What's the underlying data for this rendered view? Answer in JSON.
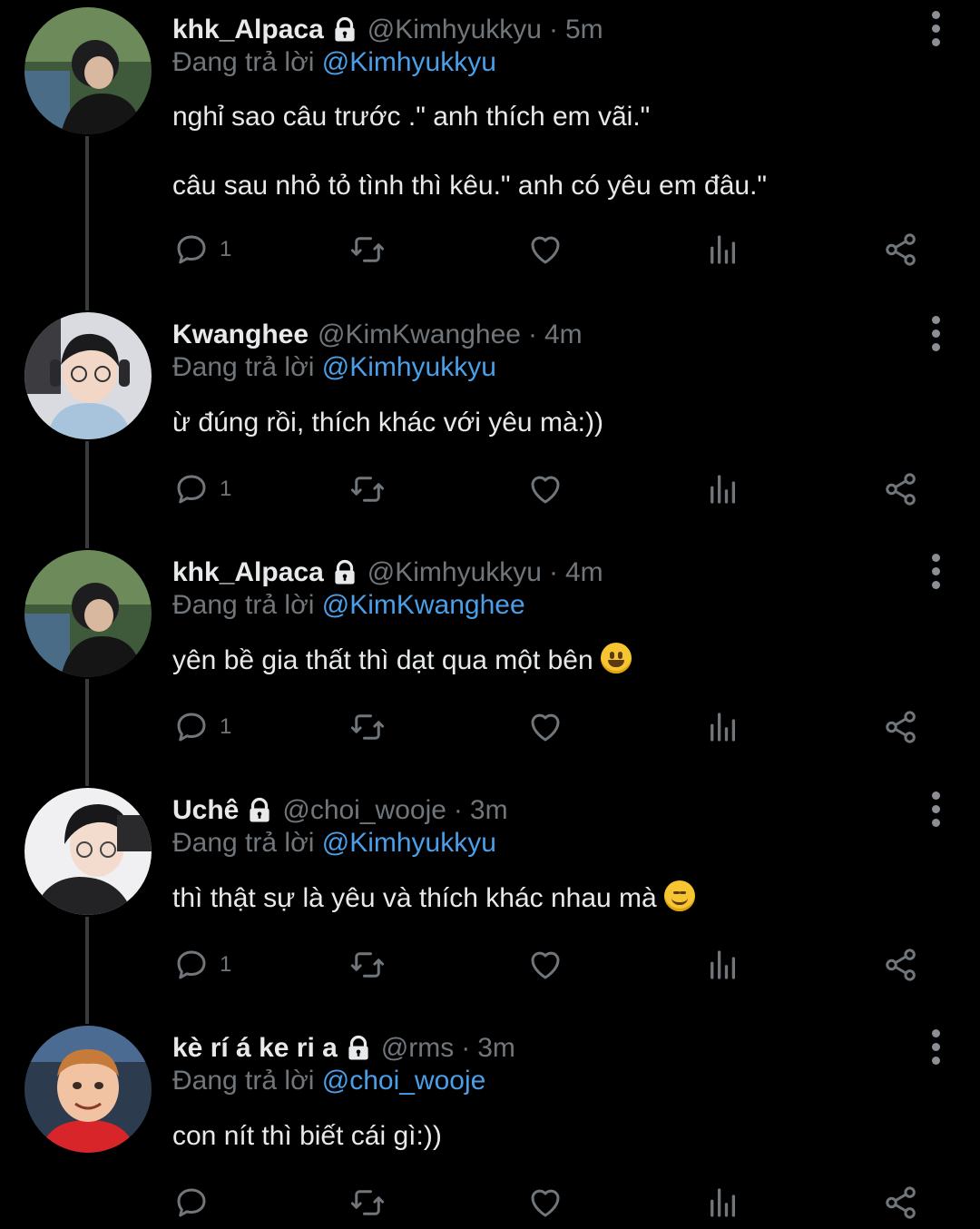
{
  "reply_prefix": "Đang trả lời",
  "dot": "·",
  "tweets": [
    {
      "name": "khk_Alpaca",
      "locked": true,
      "handle": "@Kimhyukkyu",
      "time": "5m",
      "reply_to": "@Kimhyukkyu",
      "text": "nghỉ sao câu trước .\" anh thích em vãi.\"\n\ncâu sau nhỏ tỏ tình thì kêu.\" anh có yêu em đâu.\"",
      "reply_count": "1"
    },
    {
      "name": "Kwanghee",
      "locked": false,
      "handle": "@KimKwanghee",
      "time": "4m",
      "reply_to": "@Kimhyukkyu",
      "text": "ừ đúng rồi, thích khác với yêu mà:))",
      "reply_count": "1"
    },
    {
      "name": "khk_Alpaca",
      "locked": true,
      "handle": "@Kimhyukkyu",
      "time": "4m",
      "reply_to": "@KimKwanghee",
      "text": "yên bề gia thất thì dạt qua một bên",
      "emoji": "grinning-face",
      "reply_count": "1"
    },
    {
      "name": "Uchê",
      "locked": true,
      "handle": "@choi_wooje",
      "time": "3m",
      "reply_to": "@Kimhyukkyu",
      "text": "thì thật sự là yêu và thích khác nhau mà",
      "emoji": "smiling-face",
      "reply_count": "1"
    },
    {
      "name": "kè rí á ke ri a",
      "locked": true,
      "handle": "@rms",
      "time": "3m",
      "reply_to": "@choi_wooje",
      "text": "con nít thì biết cái gì:))",
      "reply_count": ""
    }
  ],
  "icons": [
    "reply-icon",
    "retweet-icon",
    "like-icon",
    "views-icon",
    "share-icon",
    "lock-icon",
    "more-icon"
  ],
  "colors": {
    "background": "#000000",
    "text": "#e7e9ea",
    "muted": "#71767b",
    "mention": "#4a9fe8",
    "thread_line": "#3a3b3d"
  }
}
